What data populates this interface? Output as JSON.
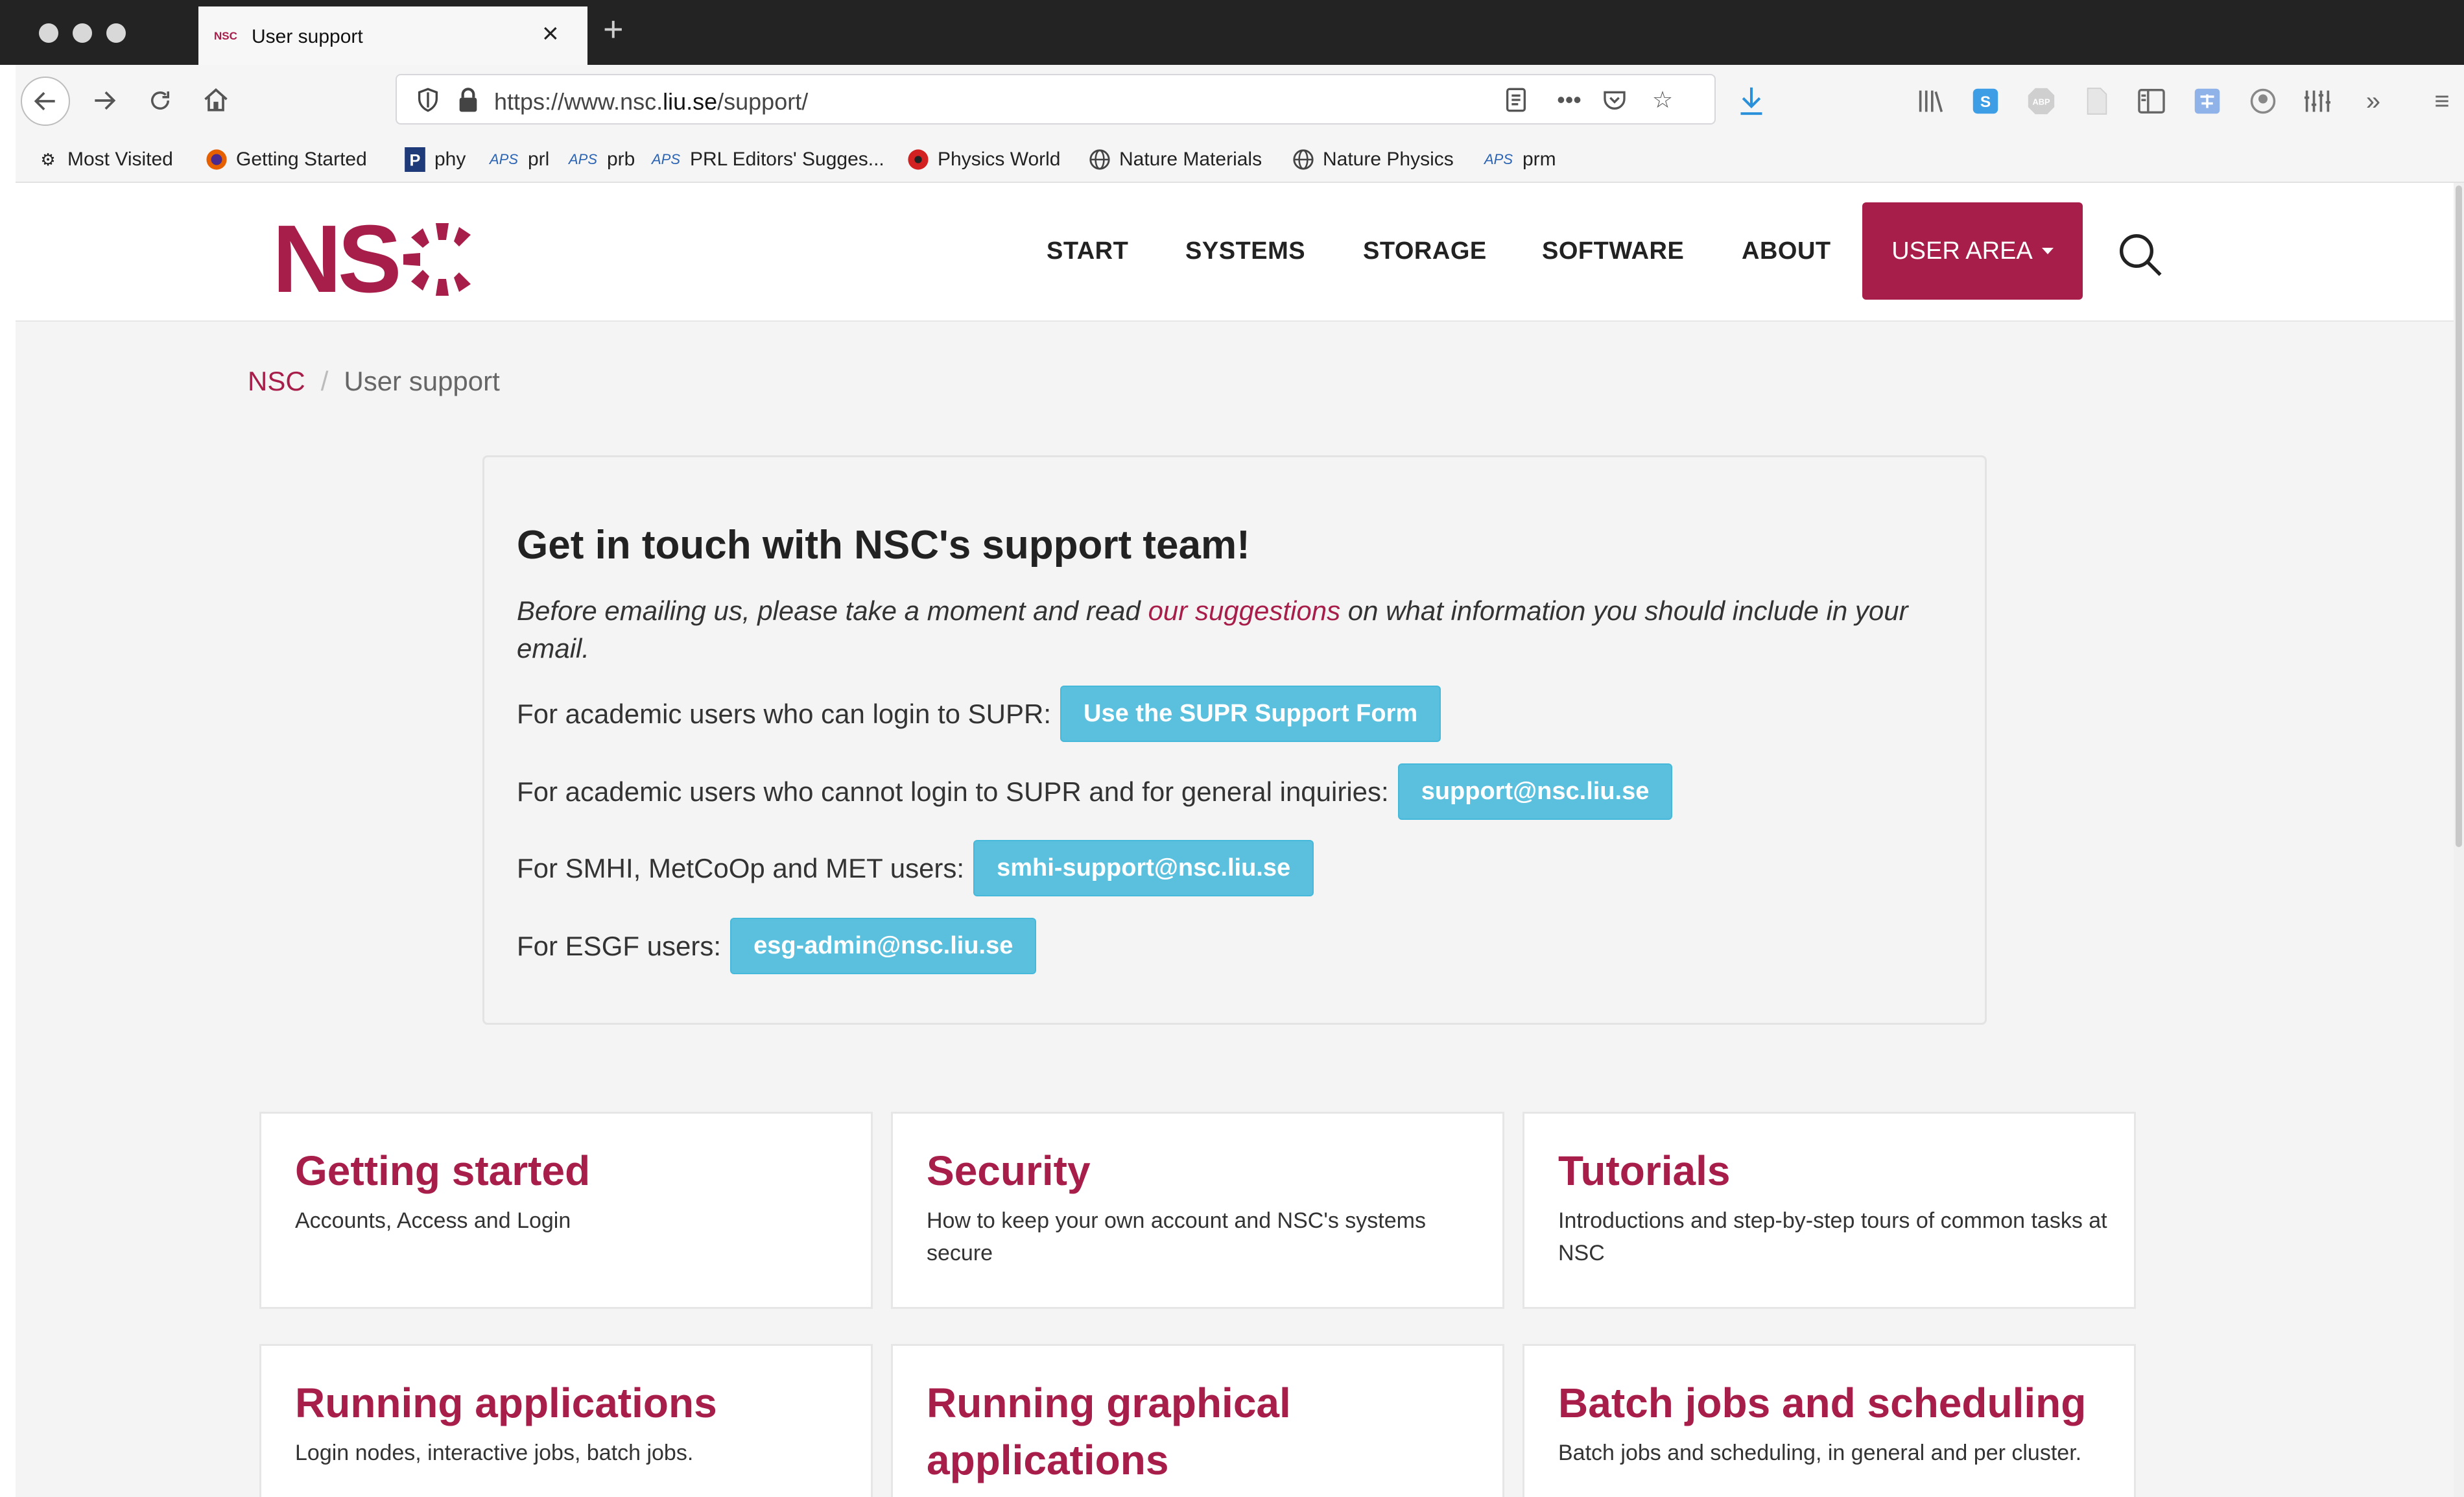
{
  "browser": {
    "tab_title": "User support",
    "tab_favicon_text": "NSC",
    "url": "https://www.nsc.liu.se/support/",
    "url_host": "https://www.nsc.",
    "url_domain": "liu.se",
    "url_path": "/support/",
    "bookmarks": [
      {
        "label": "Most Visited",
        "icon": "gear-icon"
      },
      {
        "label": "Getting Started",
        "icon": "firefox-icon"
      },
      {
        "label": "phy",
        "icon": "p-icon"
      },
      {
        "label": "prl",
        "icon": "aps-icon"
      },
      {
        "label": "prb",
        "icon": "aps-icon"
      },
      {
        "label": "PRL Editors' Sugges...",
        "icon": "aps-icon"
      },
      {
        "label": "Physics World",
        "icon": "physicsworld-icon"
      },
      {
        "label": "Nature Materials",
        "icon": "globe-icon"
      },
      {
        "label": "Nature Physics",
        "icon": "globe-icon"
      },
      {
        "label": "prm",
        "icon": "aps-icon"
      }
    ],
    "aps_icon_text": "APS"
  },
  "site": {
    "logo_text": "NSC",
    "nav": [
      "START",
      "SYSTEMS",
      "STORAGE",
      "SOFTWARE",
      "ABOUT"
    ],
    "user_area": "USER AREA",
    "brand_color": "#a81e4a",
    "button_color": "#5bc0de"
  },
  "breadcrumb": {
    "home": "NSC",
    "separator": "/",
    "current": "User support"
  },
  "support": {
    "heading": "Get in touch with NSC's support team!",
    "intro_before": "Before emailing us, please take a moment and read ",
    "intro_link": "our suggestions",
    "intro_after": " on what information you should include in your email.",
    "rows": [
      {
        "text": "For academic users who can login to SUPR:",
        "button": "Use the SUPR Support Form"
      },
      {
        "text": "For academic users who cannot login to SUPR and for general inquiries:",
        "button": "support@nsc.liu.se"
      },
      {
        "text": "For SMHI, MetCoOp and MET users:",
        "button": "smhi-support@nsc.liu.se"
      },
      {
        "text": "For ESGF users:",
        "button": "esg-admin@nsc.liu.se"
      }
    ]
  },
  "cards": [
    {
      "title": "Getting started",
      "desc": "Accounts, Access and Login"
    },
    {
      "title": "Security",
      "desc": "How to keep your own account and NSC's systems secure"
    },
    {
      "title": "Tutorials",
      "desc": "Introductions and step-by-step tours of common tasks at NSC"
    },
    {
      "title": "Running applications",
      "desc": "Login nodes, interactive jobs, batch jobs."
    },
    {
      "title": "Running graphical applications",
      "desc": ""
    },
    {
      "title": "Batch jobs and scheduling",
      "desc": "Batch jobs and scheduling, in general and per cluster."
    }
  ]
}
